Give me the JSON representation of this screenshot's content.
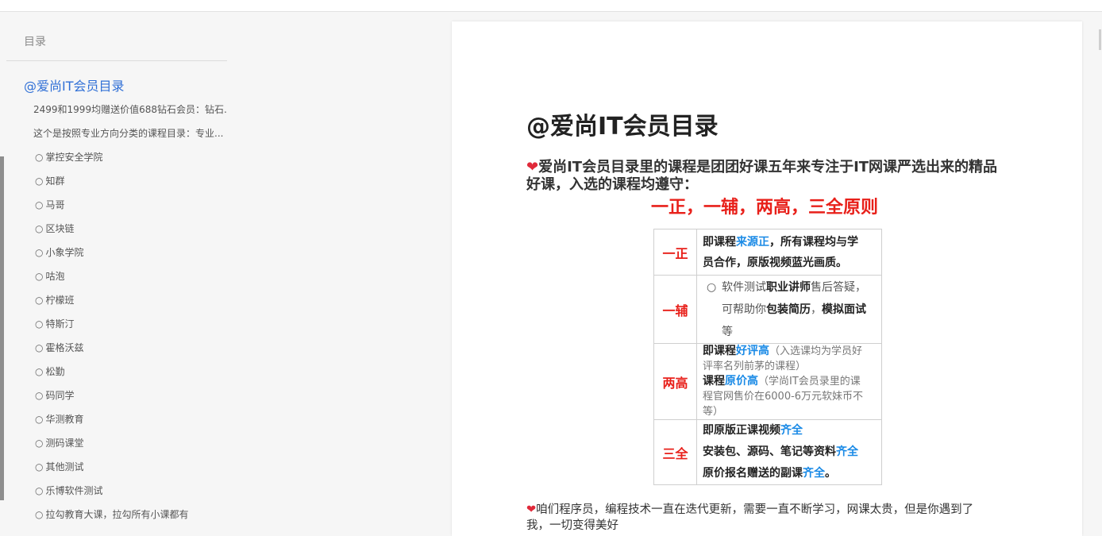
{
  "colors": {
    "red": "#e8201a",
    "blue": "#1a8ae6",
    "link": "#2f6fd6",
    "heart": "#e02a3a"
  },
  "sidebar": {
    "heading": "目录",
    "title": "@爱尚IT会员目录",
    "entries": [
      "2499和1999均赠送价值688钻石会员：钻石...",
      "这个是按照专业方向分类的课程目录：专业..."
    ],
    "sub_entries": [
      "掌控安全学院",
      "知群",
      "马哥",
      "区块链",
      "小象学院",
      "咕泡",
      "柠檬班",
      "特斯汀",
      "霍格沃兹",
      "松勤",
      "码同学",
      "华测教育",
      "测码课堂",
      "其他测试",
      "乐博软件测试",
      "拉勾教育大课，拉勾所有小课都有"
    ]
  },
  "article": {
    "title": "@爱尚IT会员目录",
    "intro_icon": "heart-icon",
    "intro": "爱尚IT会员目录里的课程是团团好课五年来专注于IT网课严选出来的精品好课，入选的课程均遵守：",
    "principle_heading": "一正，一辅，两高，三全原则",
    "principles": [
      {
        "label": "一正",
        "segments": [
          "即课程",
          "来源正",
          "，所有课程均与学员合作，原版视频蓝光画质。"
        ]
      },
      {
        "label": "一辅",
        "segments": [
          "软件测试",
          "职业讲师",
          "售后答疑，可帮助你",
          "包装简历",
          "，",
          "模拟面试",
          "等"
        ]
      },
      {
        "label": "两高",
        "lines": [
          {
            "lead": "即课程",
            "key": "好评高",
            "note": "（入选课均为学员好评率名列前茅的课程）"
          },
          {
            "lead": "课程",
            "key": "原价高",
            "note": "（学尚IT会员录里的课程官网售价在6000-6万元软妹币不等）"
          }
        ]
      },
      {
        "label": "三全",
        "lines": [
          {
            "lead": "即原版正课视频",
            "key": "齐全"
          },
          {
            "lead": "安装包、源码、笔记等资料",
            "key": "齐全"
          },
          {
            "lead": "原价报名赠送的副课",
            "key": "齐全",
            "tail": "。"
          }
        ]
      }
    ],
    "closing_icon": "heart-icon",
    "closing": "咱们程序员，编程技术一直在迭代更新，需要一直不断学习，网课太贵，但是你遇到了我，一切变得美好"
  }
}
